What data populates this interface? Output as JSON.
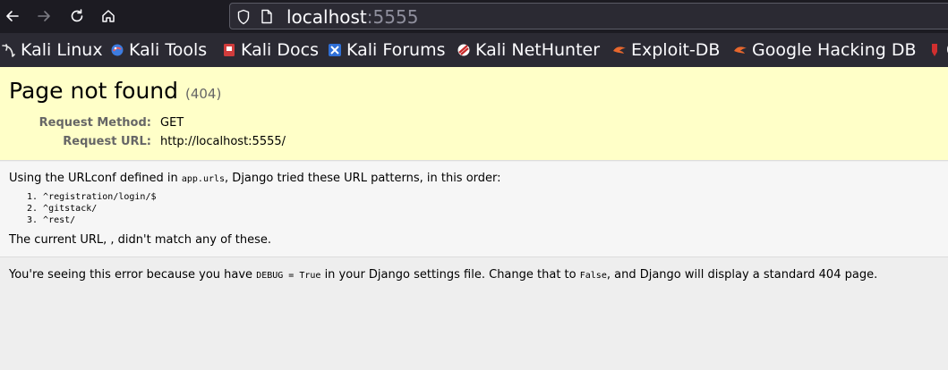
{
  "browser": {
    "url_host": "localhost",
    "url_port": ":5555",
    "bookmarks": [
      {
        "label": "Kali Linux",
        "icon": "kali-dragon-icon"
      },
      {
        "label": "Kali Tools",
        "icon": "kali-tools-icon"
      },
      {
        "label": "Kali Docs",
        "icon": "kali-docs-icon"
      },
      {
        "label": "Kali Forums",
        "icon": "kali-forums-icon"
      },
      {
        "label": "Kali NetHunter",
        "icon": "kali-nethunter-icon"
      },
      {
        "label": "Exploit-DB",
        "icon": "exploit-db-icon"
      },
      {
        "label": "Google Hacking DB",
        "icon": "ghdb-icon"
      },
      {
        "label": "O",
        "icon": "offsec-icon"
      }
    ]
  },
  "summary": {
    "title": "Page not found",
    "code": "(404)",
    "request_method_label": "Request Method:",
    "request_method": "GET",
    "request_url_label": "Request URL:",
    "request_url": "http://localhost:5555/"
  },
  "info": {
    "intro_before": "Using the URLconf defined in ",
    "intro_module": "app.urls",
    "intro_after": ", Django tried these URL patterns, in this order:",
    "patterns": [
      "1. ^registration/login/$",
      "2. ^gitstack/",
      "3. ^rest/"
    ],
    "no_match": "The current URL, , didn't match any of these."
  },
  "explanation": {
    "part1": "You're seeing this error because you have ",
    "debug_code": "DEBUG = True",
    "part2": " in your Django settings file. Change that to ",
    "false_code": "False",
    "part3": ", and Django will display a standard 404 page."
  },
  "colors": {
    "chrome_dark": "#1c1b22",
    "chrome_toolbar": "#2b2a33",
    "summary_bg": "#ffffc8",
    "info_bg": "#f6f6f6"
  }
}
